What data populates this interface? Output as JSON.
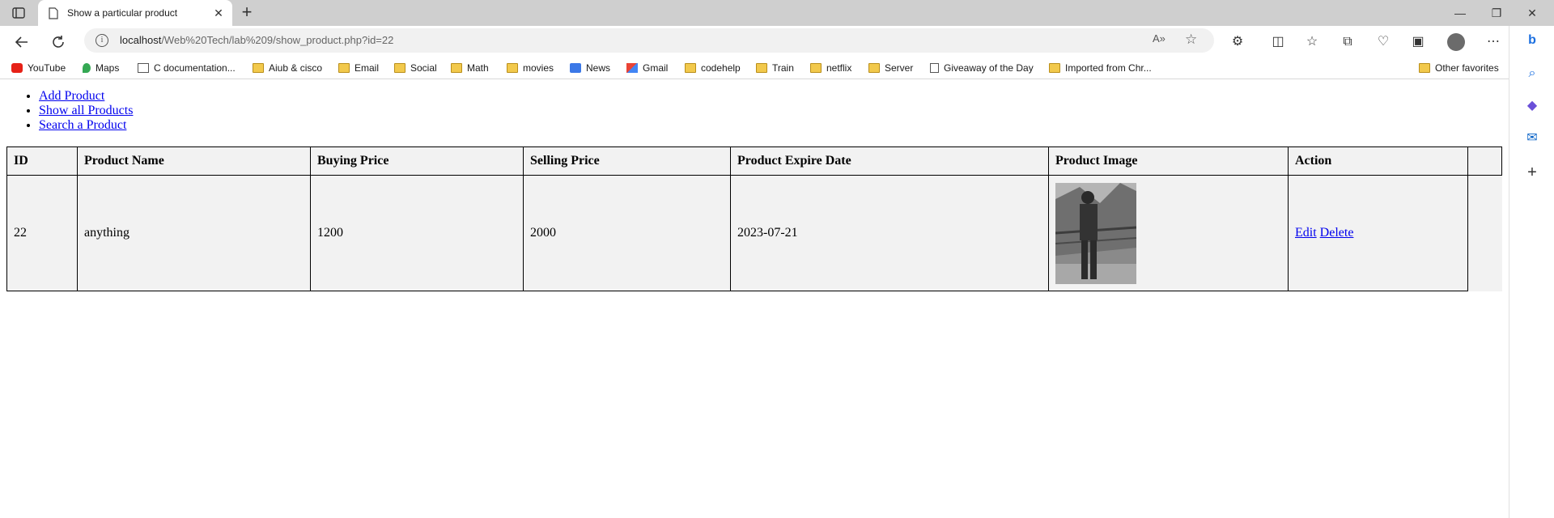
{
  "browser": {
    "tab": {
      "title": "Show a particular product"
    },
    "address": {
      "host": "localhost",
      "path": "/Web%20Tech/lab%209/show_product.php?id=22"
    },
    "bookmarks": [
      {
        "label": "YouTube",
        "icon": "youtube-icon"
      },
      {
        "label": "Maps",
        "icon": "maps-icon"
      },
      {
        "label": "C documentation...",
        "icon": "page-icon"
      },
      {
        "label": "Aiub & cisco",
        "icon": "folder-icon"
      },
      {
        "label": "Email",
        "icon": "folder-icon"
      },
      {
        "label": "Social",
        "icon": "folder-icon"
      },
      {
        "label": "Math",
        "icon": "folder-icon"
      },
      {
        "label": "movies",
        "icon": "folder-icon"
      },
      {
        "label": "News",
        "icon": "news-icon"
      },
      {
        "label": "Gmail",
        "icon": "gmail-icon"
      },
      {
        "label": "codehelp",
        "icon": "folder-icon"
      },
      {
        "label": "Train",
        "icon": "folder-icon"
      },
      {
        "label": "netflix",
        "icon": "folder-icon"
      },
      {
        "label": "Server",
        "icon": "folder-icon"
      },
      {
        "label": "Giveaway of the Day",
        "icon": "page-icon"
      },
      {
        "label": "Imported from Chr...",
        "icon": "folder-icon"
      }
    ],
    "other_favorites": "Other favorites"
  },
  "page": {
    "nav_links": [
      "Add Product",
      "Show all Products",
      "Search a Product"
    ],
    "table": {
      "headers": [
        "ID",
        "Product Name",
        "Buying Price",
        "Selling Price",
        "Product Expire Date",
        "Product Image",
        "Action"
      ],
      "row": {
        "id": "22",
        "name": "anything",
        "buying_price": "1200",
        "selling_price": "2000",
        "expire_date": "2023-07-21",
        "edit_label": "Edit",
        "delete_label": "Delete"
      }
    }
  },
  "colors": {
    "link": "#0000ee",
    "table_bg": "#f2f2f2",
    "folder": "#f2c94c"
  }
}
